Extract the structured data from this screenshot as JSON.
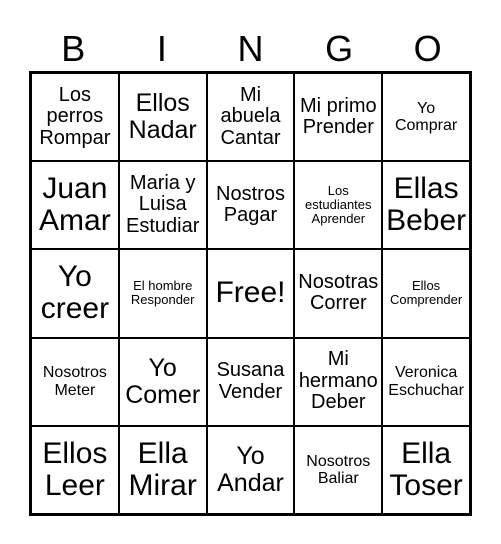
{
  "header": [
    "B",
    "I",
    "N",
    "G",
    "O"
  ],
  "cells": [
    {
      "text": "Los perros Rompar",
      "size": "md"
    },
    {
      "text": "Ellos Nadar",
      "size": "lg"
    },
    {
      "text": "Mi abuela Cantar",
      "size": "md"
    },
    {
      "text": "Mi primo Prender",
      "size": "md"
    },
    {
      "text": "Yo Comprar",
      "size": "sm"
    },
    {
      "text": "Juan Amar",
      "size": "xl"
    },
    {
      "text": "Maria y Luisa Estudiar",
      "size": "md"
    },
    {
      "text": "Nostros Pagar",
      "size": "md"
    },
    {
      "text": "Los estudiantes Aprender",
      "size": "xs"
    },
    {
      "text": "Ellas Beber",
      "size": "xl"
    },
    {
      "text": "Yo creer",
      "size": "xl"
    },
    {
      "text": "El hombre Responder",
      "size": "xs"
    },
    {
      "text": "Free!",
      "size": "xl"
    },
    {
      "text": "Nosotras Correr",
      "size": "md"
    },
    {
      "text": "Ellos Comprender",
      "size": "xs"
    },
    {
      "text": "Nosotros Meter",
      "size": "sm"
    },
    {
      "text": "Yo Comer",
      "size": "lg"
    },
    {
      "text": "Susana Vender",
      "size": "md"
    },
    {
      "text": "Mi hermano Deber",
      "size": "md"
    },
    {
      "text": "Veronica Eschuchar",
      "size": "sm"
    },
    {
      "text": "Ellos Leer",
      "size": "xl"
    },
    {
      "text": "Ella Mirar",
      "size": "xl"
    },
    {
      "text": "Yo Andar",
      "size": "lg"
    },
    {
      "text": "Nosotros Baliar",
      "size": "sm"
    },
    {
      "text": "Ella Toser",
      "size": "xl"
    }
  ]
}
